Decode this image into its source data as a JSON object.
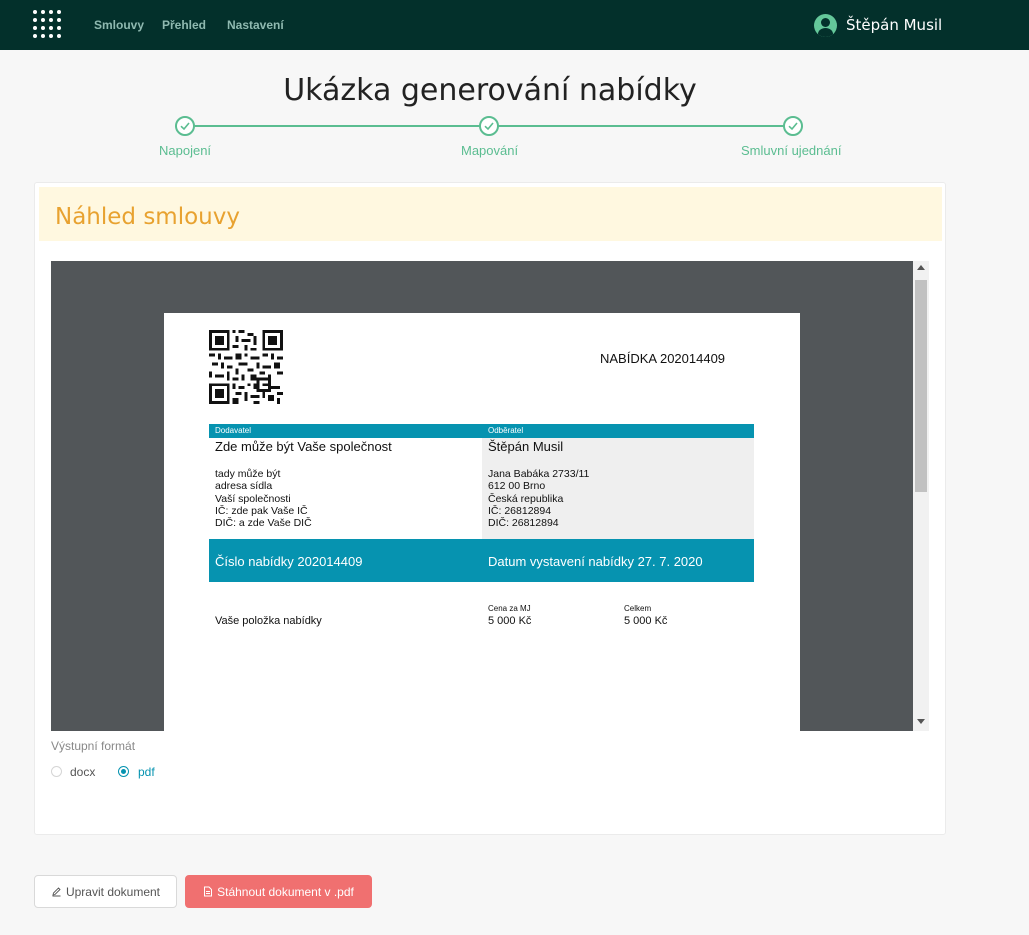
{
  "nav": {
    "apps_icon": "apps-grid-icon",
    "items": [
      {
        "label": "Smlouvy"
      },
      {
        "label": "Přehled"
      },
      {
        "label": "Nastavení"
      }
    ],
    "user": {
      "name": "Štěpán Musil",
      "icon": "user-avatar-icon"
    }
  },
  "page": {
    "title": "Ukázka generování nabídky"
  },
  "stepper": {
    "color": "#5bbd91",
    "steps": [
      {
        "label": "Napojení",
        "status": "done"
      },
      {
        "label": "Mapování",
        "status": "done"
      },
      {
        "label": "Smluvní ujednání",
        "status": "done"
      }
    ]
  },
  "preview": {
    "title": "Náhled smlouvy",
    "title_color": "#e8a230",
    "document": {
      "offer_title": "NABÍDKA 202014409",
      "supplier": {
        "label": "Dodavatel",
        "name": "Zde může být Vaše společnost",
        "lines": [
          "tady může být",
          "adresa sídla",
          "Vaší společnosti",
          "IČ: zde pak Vaše IČ",
          "DIČ: a zde Vaše DIČ"
        ]
      },
      "customer": {
        "label": "Odběratel",
        "name": "Štěpán Musil",
        "lines": [
          "Jana Babáka 2733/11",
          "612 00 Brno",
          "Česká republika",
          "IČ: 26812894",
          "DIČ: 26812894"
        ]
      },
      "offer_number": "Číslo nabídky 202014409",
      "issue_date": "Datum vystavení nabídky 27. 7. 2020",
      "accent_color": "#0693b0",
      "items_header": {
        "unit_price": "Cena za MJ",
        "total": "Celkem"
      },
      "items": [
        {
          "name": "Vaše položka nabídky",
          "unit_price": "5 000 Kč",
          "total": "5 000 Kč"
        }
      ]
    }
  },
  "format": {
    "label": "Výstupní formát",
    "options": [
      {
        "label": "docx",
        "selected": false
      },
      {
        "label": "pdf",
        "selected": true
      }
    ]
  },
  "actions": {
    "edit_label": "Upravit dokument",
    "download_label": "Stáhnout dokument v .pdf",
    "download_color": "#f07070"
  }
}
